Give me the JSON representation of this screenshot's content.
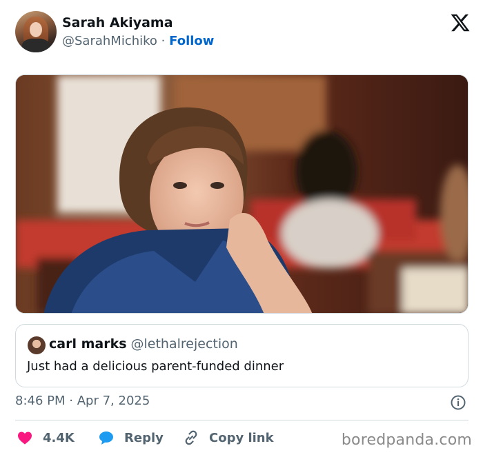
{
  "author": {
    "name": "Sarah Akiyama",
    "handle": "@SarahMichiko",
    "separator": "·",
    "follow_label": "Follow"
  },
  "platform_icon": "x-logo-icon",
  "photo": {
    "description_icon": "photo"
  },
  "quoted": {
    "name": "carl marks",
    "handle": "@lethalrejection",
    "text": "Just had a delicious parent-funded dinner"
  },
  "timestamp": {
    "time": "8:46 PM",
    "separator": "·",
    "date": "Apr 7, 2025"
  },
  "actions": {
    "like_count": "4.4K",
    "reply_label": "Reply",
    "copy_label": "Copy link"
  },
  "watermark": "boredpanda.com",
  "colors": {
    "like": "#f91880",
    "reply": "#1d9bf0",
    "follow": "#0066cc",
    "muted": "#536471"
  }
}
